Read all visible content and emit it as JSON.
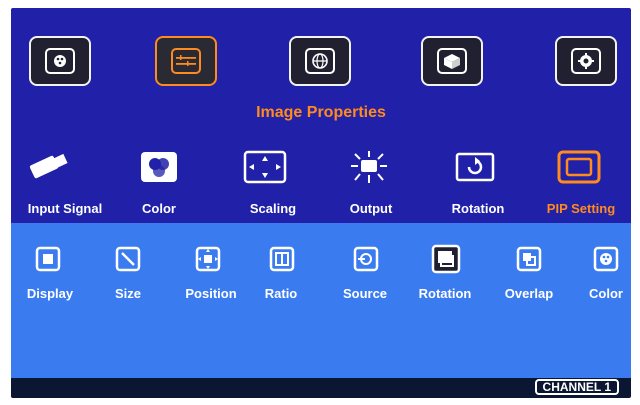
{
  "top_menu": {
    "title": "Image Properties",
    "items": [
      {
        "icon": "palette-icon"
      },
      {
        "icon": "image-properties-icon",
        "active": true
      },
      {
        "icon": "globe-icon"
      },
      {
        "icon": "3d-icon"
      },
      {
        "icon": "gear-icon"
      }
    ]
  },
  "mid_menu": {
    "items": [
      {
        "label": "Input Signal",
        "icon": "usb-icon"
      },
      {
        "label": "Color",
        "icon": "rgb-icon"
      },
      {
        "label": "Scaling",
        "icon": "scaling-icon"
      },
      {
        "label": "Output",
        "icon": "output-icon"
      },
      {
        "label": "Rotation",
        "icon": "rotation-icon"
      },
      {
        "label": "PIP Setting",
        "icon": "pip-icon",
        "active": true
      }
    ]
  },
  "low_menu": {
    "items": [
      {
        "label": "Display",
        "icon": "display-icon"
      },
      {
        "label": "Size",
        "icon": "size-icon"
      },
      {
        "label": "Position",
        "icon": "position-icon"
      },
      {
        "label": "Ratio",
        "icon": "ratio-icon"
      },
      {
        "label": "Source",
        "icon": "source-icon"
      },
      {
        "label": "Rotation",
        "icon": "rotation-icon",
        "active": true
      },
      {
        "label": "Overlap",
        "icon": "overlap-icon"
      },
      {
        "label": "Color",
        "icon": "color-icon"
      }
    ]
  },
  "channel": "CHANNEL 1",
  "colors": {
    "top_bg": "#2020a8",
    "bottom_bg": "#3a7cf0",
    "accent": "#ff8a1e",
    "text": "#ffffff"
  }
}
